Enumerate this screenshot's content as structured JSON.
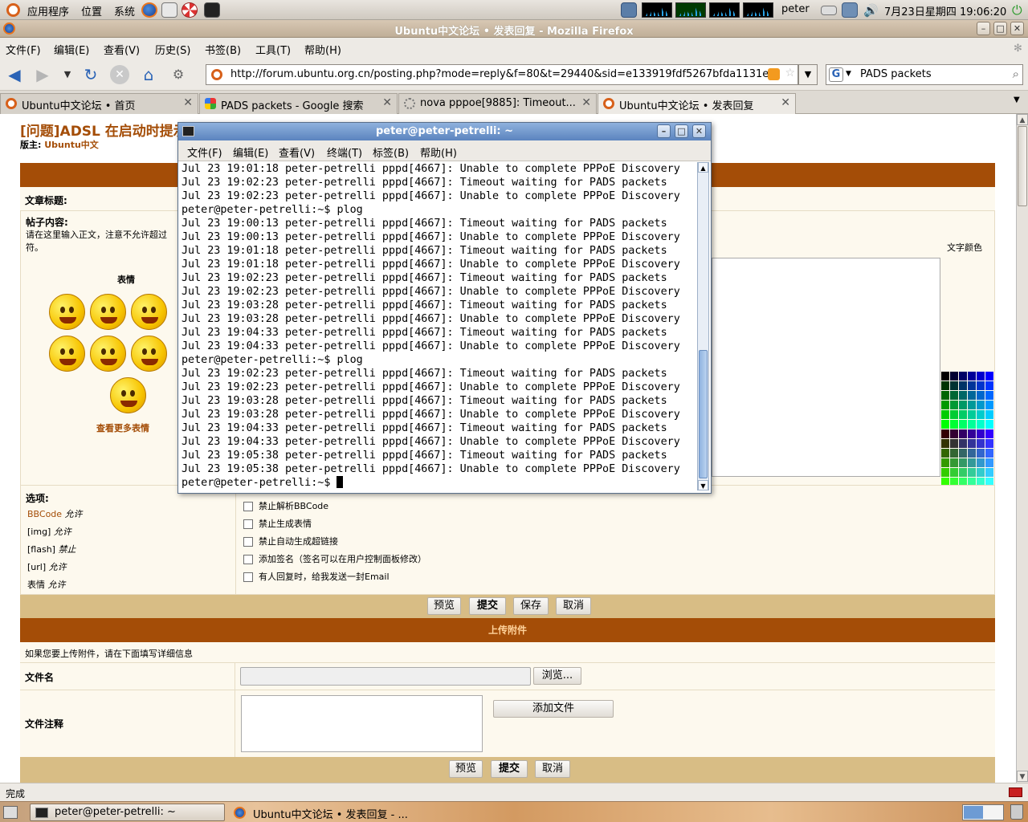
{
  "top_panel": {
    "menus": [
      "应用程序",
      "位置",
      "系统"
    ],
    "user": "peter",
    "clock": "7月23日星期四  19:06:20"
  },
  "firefox": {
    "window_title": "Ubuntu中文论坛 • 发表回复 - Mozilla Firefox",
    "menu": [
      "文件(F)",
      "编辑(E)",
      "查看(V)",
      "历史(S)",
      "书签(B)",
      "工具(T)",
      "帮助(H)"
    ],
    "url": "http://forum.ubuntu.org.cn/posting.php?mode=reply&f=80&t=29440&sid=e133919fdf5267bfda1131efJ",
    "search": "PADS packets",
    "tabs": [
      {
        "label": "Ubuntu中文论坛 • 首页"
      },
      {
        "label": "PADS packets - Google 搜索"
      },
      {
        "label": "nova pppoe[9885]: Timeout..."
      },
      {
        "label": "Ubuntu中文论坛 • 发表回复"
      }
    ],
    "status": "完成"
  },
  "page": {
    "thread_title": "[问题]ADSL 在启动时提示...",
    "moderator_label": "版主:",
    "moderator": "Ubuntu中文",
    "subject_label": "文章标题:",
    "content_label": "帖子内容:",
    "content_hint": "请在这里输入正文，注意不允许超过",
    "content_hint2": "符。",
    "smilies_title": "表情",
    "more_smilies": "查看更多表情",
    "text_color": "文字颜色",
    "options_title": "选项:",
    "options_left": [
      {
        "a": "BBCode",
        "b": "允许"
      },
      {
        "a": "[img]",
        "b": "允许"
      },
      {
        "a": "[flash]",
        "b": "禁止"
      },
      {
        "a": "[url]",
        "b": "允许"
      },
      {
        "a": "表情",
        "b": "允许"
      }
    ],
    "options_right": [
      "禁止解析BBCode",
      "禁止生成表情",
      "禁止自动生成超链接",
      "添加签名（签名可以在用户控制面板修改）",
      "有人回复时，给我发送一封Email"
    ],
    "buttons1": [
      "预览",
      "提交",
      "保存",
      "取消"
    ],
    "upload_title": "上传附件",
    "upload_hint": "如果您要上传附件，请在下面填写详细信息",
    "filename_label": "文件名",
    "browse": "浏览...",
    "comment_label": "文件注释",
    "add_file": "添加文件",
    "buttons2": [
      "预览",
      "提交",
      "取消"
    ]
  },
  "terminal": {
    "title": "peter@peter-petrelli: ~",
    "menu": [
      "文件(F)",
      "编辑(E)",
      "查看(V)",
      "终端(T)",
      "标签(B)",
      "帮助(H)"
    ],
    "lines": [
      "Jul 23 19:01:18 peter-petrelli pppd[4667]: Unable to complete PPPoE Discovery",
      "Jul 23 19:02:23 peter-petrelli pppd[4667]: Timeout waiting for PADS packets",
      "Jul 23 19:02:23 peter-petrelli pppd[4667]: Unable to complete PPPoE Discovery",
      "peter@peter-petrelli:~$ plog",
      "Jul 23 19:00:13 peter-petrelli pppd[4667]: Timeout waiting for PADS packets",
      "Jul 23 19:00:13 peter-petrelli pppd[4667]: Unable to complete PPPoE Discovery",
      "Jul 23 19:01:18 peter-petrelli pppd[4667]: Timeout waiting for PADS packets",
      "Jul 23 19:01:18 peter-petrelli pppd[4667]: Unable to complete PPPoE Discovery",
      "Jul 23 19:02:23 peter-petrelli pppd[4667]: Timeout waiting for PADS packets",
      "Jul 23 19:02:23 peter-petrelli pppd[4667]: Unable to complete PPPoE Discovery",
      "Jul 23 19:03:28 peter-petrelli pppd[4667]: Timeout waiting for PADS packets",
      "Jul 23 19:03:28 peter-petrelli pppd[4667]: Unable to complete PPPoE Discovery",
      "Jul 23 19:04:33 peter-petrelli pppd[4667]: Timeout waiting for PADS packets",
      "Jul 23 19:04:33 peter-petrelli pppd[4667]: Unable to complete PPPoE Discovery",
      "peter@peter-petrelli:~$ plog",
      "Jul 23 19:02:23 peter-petrelli pppd[4667]: Timeout waiting for PADS packets",
      "Jul 23 19:02:23 peter-petrelli pppd[4667]: Unable to complete PPPoE Discovery",
      "Jul 23 19:03:28 peter-petrelli pppd[4667]: Timeout waiting for PADS packets",
      "Jul 23 19:03:28 peter-petrelli pppd[4667]: Unable to complete PPPoE Discovery",
      "Jul 23 19:04:33 peter-petrelli pppd[4667]: Timeout waiting for PADS packets",
      "Jul 23 19:04:33 peter-petrelli pppd[4667]: Unable to complete PPPoE Discovery",
      "Jul 23 19:05:38 peter-petrelli pppd[4667]: Timeout waiting for PADS packets",
      "Jul 23 19:05:38 peter-petrelli pppd[4667]: Unable to complete PPPoE Discovery"
    ],
    "prompt": "peter@peter-petrelli:~$ "
  },
  "taskbar": {
    "items": [
      "peter@peter-petrelli: ~",
      "Ubuntu中文论坛 • 发表回复 - ..."
    ]
  }
}
